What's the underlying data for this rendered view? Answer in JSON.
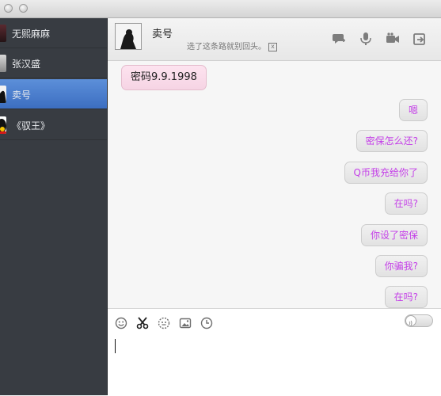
{
  "window": {
    "traffic_lights": [
      "close",
      "minimize"
    ]
  },
  "sidebar": {
    "contacts": [
      {
        "name": "无熙麻麻",
        "avatar": "photo-avatar-dark",
        "selected": false
      },
      {
        "name": "张汉盛",
        "avatar": "photo-avatar-gray",
        "selected": false
      },
      {
        "name": "卖号",
        "avatar": "silhouette-avatar",
        "selected": true
      },
      {
        "name": "《驭王》",
        "avatar": "qq-penguin-avatar",
        "selected": false
      }
    ]
  },
  "header": {
    "name": "卖号",
    "signature": "选了这条路就别回头。",
    "signature_close": "x",
    "icons": [
      "chat-bubble-icon",
      "microphone-icon",
      "video-camera-icon",
      "share-icon"
    ]
  },
  "messages": [
    {
      "text": "密码9.9.1998",
      "side": "left"
    },
    {
      "text": "嗯",
      "side": "right"
    },
    {
      "text": "密保怎么还?",
      "side": "right"
    },
    {
      "text": "Q币我充给你了",
      "side": "right"
    },
    {
      "text": "在吗?",
      "side": "right"
    },
    {
      "text": "你设了密保",
      "side": "right"
    },
    {
      "text": "你骗我?",
      "side": "right"
    },
    {
      "text": "在吗?",
      "side": "right"
    }
  ],
  "composer": {
    "tools": [
      "emoji-icon",
      "scissors-icon",
      "sticker-icon",
      "image-icon",
      "history-clock-icon"
    ],
    "voice_toggle": "off",
    "input_value": ""
  },
  "colors": {
    "sidebar_bg": "#383c42",
    "selection": "#4a7fcf",
    "outgoing_text": "#c43fe8",
    "incoming_bubble": "#fbdcea"
  }
}
